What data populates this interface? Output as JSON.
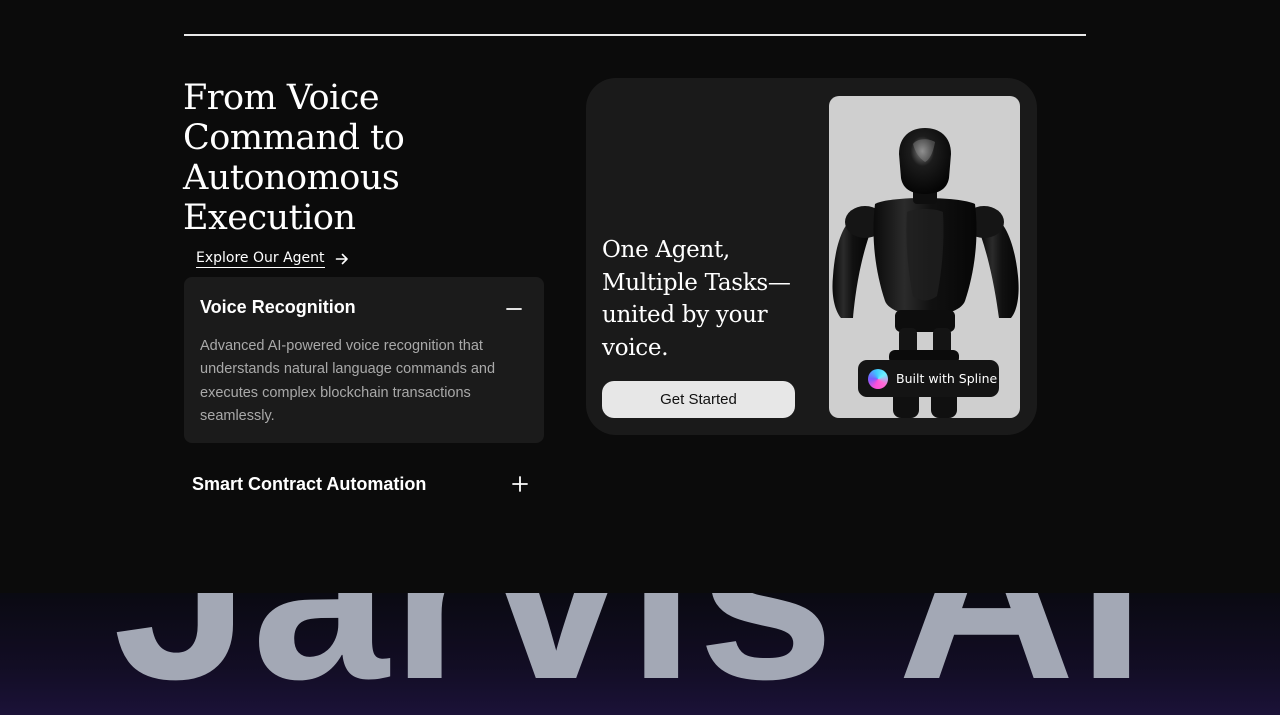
{
  "section": {
    "headline": "From Voice Command to Autonomous Execution",
    "explore_link": "Explore Our Agent"
  },
  "accordion": [
    {
      "title": "Voice Recognition",
      "expanded": true,
      "description": "Advanced AI-powered voice recognition that understands natural language commands and executes complex blockchain transactions seamlessly."
    },
    {
      "title": "Smart Contract Automation",
      "expanded": false
    }
  ],
  "feature_card": {
    "title": "One Agent, Multiple Tasks—united by your voice.",
    "cta": "Get Started",
    "badge": "Built with Spline"
  },
  "hero": {
    "word": "Jarvis AI"
  },
  "icons": {
    "explore_arrow": "arrow-right-icon",
    "expanded_toggle": "minus-icon",
    "collapsed_toggle": "plus-icon",
    "badge_logo": "spline-logo-icon"
  },
  "colors": {
    "background": "#0b0b0b",
    "card": "#1a1a1a",
    "cta_background": "#e7e7e7",
    "hero_text": "#a3a8b5",
    "hero_band": "#1b1238"
  }
}
